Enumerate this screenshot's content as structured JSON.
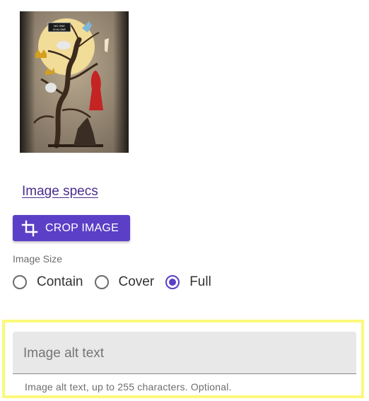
{
  "image_preview": {
    "sign_line_1": "NO ONE",
    "sign_line_2": "IS ALONE"
  },
  "links": {
    "image_specs": "Image specs"
  },
  "crop_button": {
    "label": "CROP IMAGE",
    "icon": "crop-icon",
    "color": "#5b3fc6"
  },
  "image_size": {
    "label": "Image Size",
    "options": [
      "Contain",
      "Cover",
      "Full"
    ],
    "selected": "Full"
  },
  "alt_text": {
    "placeholder": "Image alt text",
    "value": "",
    "helper": "Image alt text, up to 255 characters. Optional."
  },
  "colors": {
    "accent": "#5b3fc6",
    "link": "#4a2d8f",
    "highlight": "#fbf87b",
    "field_background": "#e8e8e8"
  }
}
